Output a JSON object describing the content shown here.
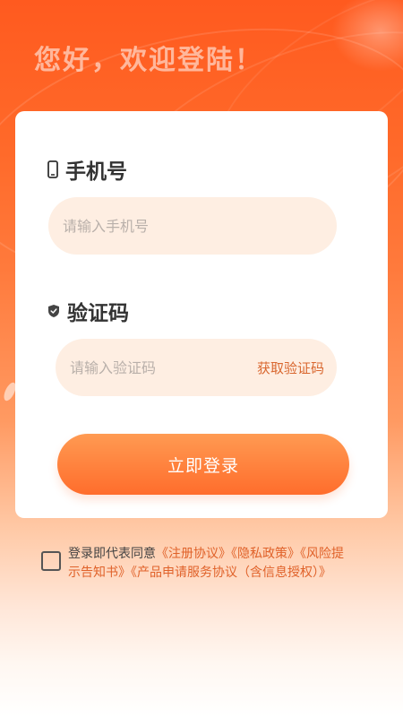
{
  "welcome": {
    "title": "您好，欢迎登陆！"
  },
  "phone": {
    "label": "手机号",
    "placeholder": "请输入手机号",
    "icon": "phone-icon"
  },
  "code": {
    "label": "验证码",
    "placeholder": "请输入验证码",
    "get_code": "获取验证码",
    "icon": "shield-icon"
  },
  "login": {
    "label": "立即登录"
  },
  "agreement": {
    "checked": false,
    "prefix": "登录即代表同意",
    "links": [
      "《注册协议》",
      "《隐私政策》",
      "《风险提示告知书》",
      "《产品申请服务协议（含信息授权）》"
    ]
  },
  "colors": {
    "brand": "#ff6a2a",
    "link": "#e0622a",
    "input_bg": "#feeee2"
  }
}
